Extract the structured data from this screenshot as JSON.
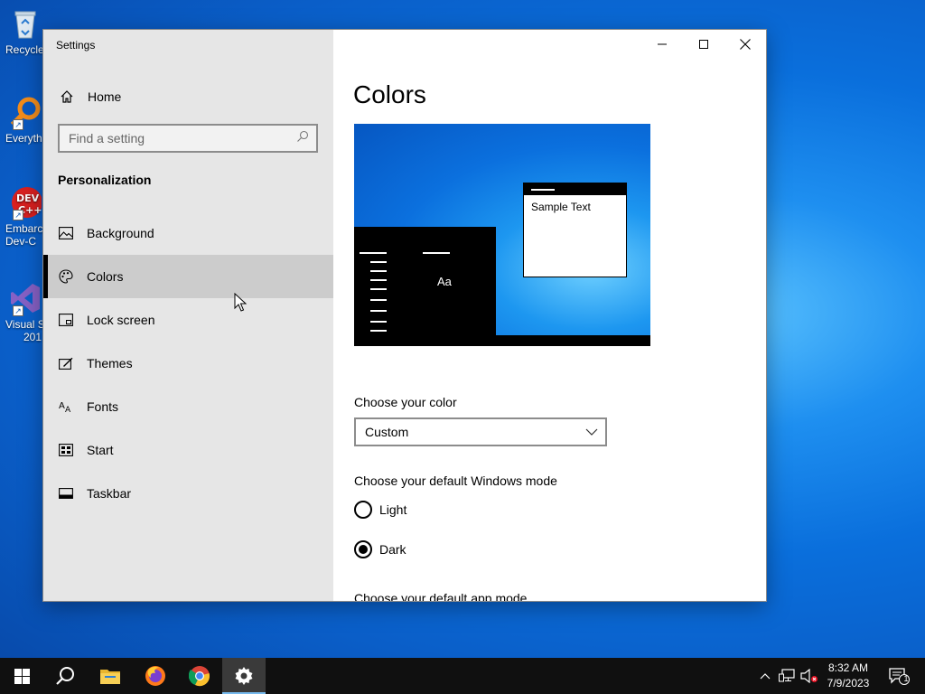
{
  "desktop": {
    "icons": [
      {
        "name": "recycle-bin",
        "label": "Recycle"
      },
      {
        "name": "everything",
        "label": "Everyth"
      },
      {
        "name": "embarcadero-dev-cpp",
        "label": "Embarca",
        "label2": "Dev-C"
      },
      {
        "name": "visual-studio",
        "label": "Visual St",
        "label2": "201"
      }
    ]
  },
  "window": {
    "title": "Settings",
    "controls": {
      "minimize": "minimize",
      "maximize": "maximize",
      "close": "close"
    }
  },
  "sidebar": {
    "home_label": "Home",
    "search_placeholder": "Find a setting",
    "section_title": "Personalization",
    "items": [
      {
        "label": "Background",
        "icon": "picture-icon",
        "selected": false
      },
      {
        "label": "Colors",
        "icon": "palette-icon",
        "selected": true
      },
      {
        "label": "Lock screen",
        "icon": "lock-screen-icon",
        "selected": false
      },
      {
        "label": "Themes",
        "icon": "themes-icon",
        "selected": false
      },
      {
        "label": "Fonts",
        "icon": "fonts-icon",
        "selected": false
      },
      {
        "label": "Start",
        "icon": "start-icon",
        "selected": false
      },
      {
        "label": "Taskbar",
        "icon": "taskbar-icon",
        "selected": false
      }
    ]
  },
  "content": {
    "title": "Colors",
    "preview": {
      "sample_text": "Sample Text",
      "aa_text": "Aa"
    },
    "choose_color_label": "Choose your color",
    "choose_color_value": "Custom",
    "windows_mode_label": "Choose your default Windows mode",
    "windows_mode_options": [
      {
        "label": "Light",
        "selected": false
      },
      {
        "label": "Dark",
        "selected": true
      }
    ],
    "app_mode_label": "Choose your default app mode"
  },
  "taskbar": {
    "apps": [
      "start-button",
      "search-button",
      "file-explorer",
      "firefox",
      "chrome",
      "settings"
    ],
    "active_app": "settings",
    "clock_time": "8:32 AM",
    "clock_date": "7/9/2023",
    "notification_count": "1"
  },
  "colors": {
    "accent": "#0078d7",
    "sidebar_bg": "#e6e6e6",
    "selected_bg": "#cccccc",
    "taskbar_bg": "#101010"
  }
}
